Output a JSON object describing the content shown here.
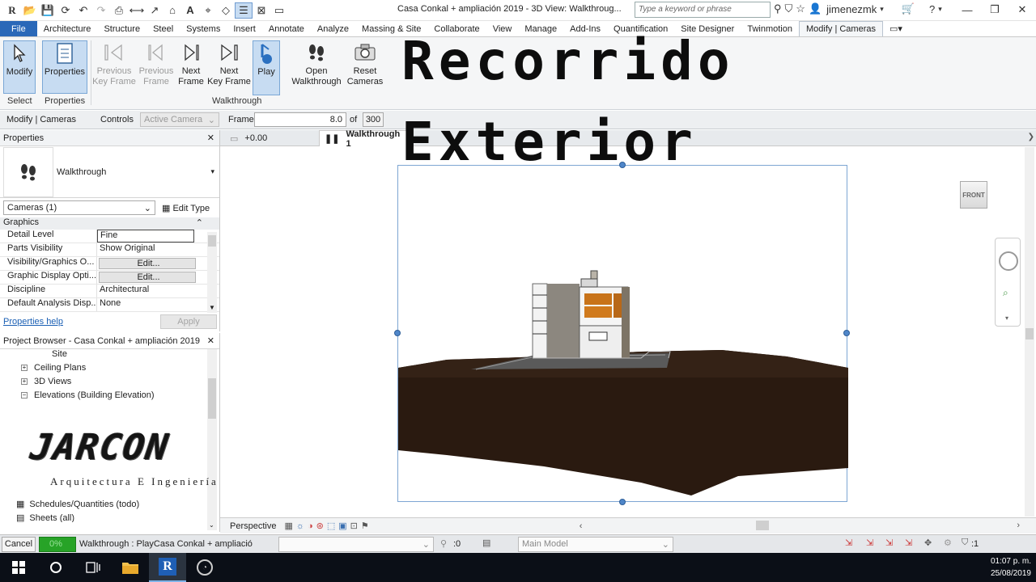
{
  "window": {
    "document_title": "Casa Conkal + ampliación 2019 - 3D View: Walkthroug...",
    "search_placeholder": "Type a keyword or phrase",
    "username": "jimenezmk"
  },
  "menu": {
    "tabs": [
      "File",
      "Architecture",
      "Structure",
      "Steel",
      "Systems",
      "Insert",
      "Annotate",
      "Analyze",
      "Massing & Site",
      "Collaborate",
      "View",
      "Manage",
      "Add-Ins",
      "Quantification",
      "Site Designer",
      "Twinmotion",
      "Modify | Cameras"
    ],
    "active_tab": "Modify | Cameras"
  },
  "ribbon": {
    "buttons": {
      "modify": "Modify",
      "properties": "Properties",
      "prev_key_1": "Previous",
      "prev_key_2": "Key Frame",
      "prev_frame_1": "Previous",
      "prev_frame_2": "Frame",
      "next_frame_1": "Next",
      "next_frame_2": "Frame",
      "next_key_1": "Next",
      "next_key_2": "Key Frame",
      "play": "Play",
      "open_walk_1": "Open",
      "open_walk_2": "Walkthrough",
      "reset_1": "Reset",
      "reset_2": "Cameras"
    },
    "panels": {
      "select": "Select",
      "properties": "Properties",
      "walkthrough": "Walkthrough"
    }
  },
  "options_bar": {
    "context": "Modify | Cameras",
    "controls_label": "Controls",
    "controls_value": "Active Camera",
    "frame_label": "Frame",
    "frame_value": "8.0",
    "of_label": "of",
    "total_frames": "300"
  },
  "properties": {
    "title": "Properties",
    "type_name": "Walkthrough",
    "instance_filter": "Cameras (1)",
    "edit_type": "Edit Type",
    "group": "Graphics",
    "rows": [
      {
        "name": "Detail Level",
        "value": "Fine"
      },
      {
        "name": "Parts Visibility",
        "value": "Show Original"
      },
      {
        "name": "Visibility/Graphics O...",
        "value": "Edit..."
      },
      {
        "name": "Graphic Display Opti...",
        "value": "Edit..."
      },
      {
        "name": "Discipline",
        "value": "Architectural"
      },
      {
        "name": "Default Analysis Disp...",
        "value": "None"
      }
    ],
    "help_link": "Properties help",
    "apply": "Apply"
  },
  "project_browser": {
    "title": "Project Browser - Casa Conkal + ampliación 2019",
    "items": [
      {
        "label": "Site"
      },
      {
        "label": "Ceiling Plans"
      },
      {
        "label": "3D Views"
      },
      {
        "label": "Elevations (Building Elevation)"
      },
      {
        "label": "Schedules/Quantities (todo)"
      },
      {
        "label": "Sheets (all)"
      }
    ]
  },
  "overlay": {
    "title_line1": "Recorrido",
    "title_line2": "Exterior",
    "logo_name": "JARCON",
    "logo_tagline": "Arquitectura E Ingeniería"
  },
  "view": {
    "tab_inactive": "+0.00",
    "tab_active": "Walkthrough 1",
    "viewcube_face": "FRONT",
    "view_mode": "Perspective"
  },
  "status_bar": {
    "cancel": "Cancel",
    "progress": "0%",
    "message": "Walkthrough : PlayCasa Conkal + ampliació",
    "selection_count": ":0",
    "model": "Main Model",
    "filter_count": ":1"
  },
  "taskbar": {
    "time": "01:07 p. m.",
    "date": "25/08/2019"
  }
}
